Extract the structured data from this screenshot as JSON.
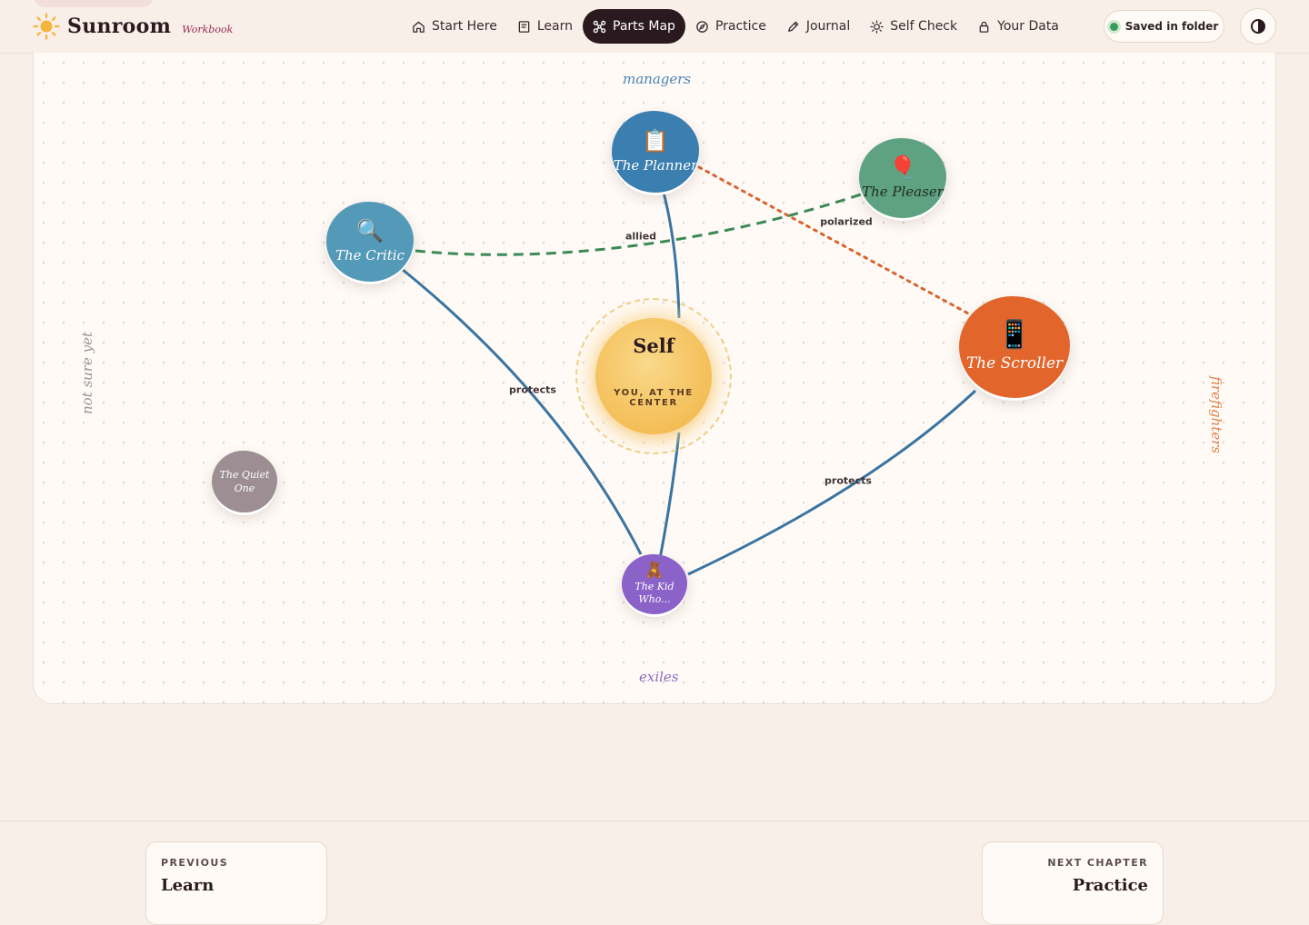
{
  "brand": {
    "name": "Sunroom",
    "subtitle": "Workbook"
  },
  "nav": {
    "items": [
      {
        "label": "Start Here",
        "icon": "home-icon",
        "active": false
      },
      {
        "label": "Learn",
        "icon": "book-icon",
        "active": false
      },
      {
        "label": "Parts Map",
        "icon": "network-icon",
        "active": true
      },
      {
        "label": "Practice",
        "icon": "compass-icon",
        "active": false
      },
      {
        "label": "Journal",
        "icon": "pencil-icon",
        "active": false
      },
      {
        "label": "Self Check",
        "icon": "sun-small-icon",
        "active": false
      },
      {
        "label": "Your Data",
        "icon": "lock-icon",
        "active": false
      }
    ],
    "saved_label": "Saved in folder",
    "theme_icon": "contrast-icon"
  },
  "map": {
    "zones": {
      "managers": "managers",
      "exiles": "exiles",
      "firefighters": "firefighters",
      "unsure": "not sure yet"
    },
    "self": {
      "title": "Self",
      "subtitle": "YOU, AT THE CENTER",
      "color": "#f4be57"
    },
    "parts": [
      {
        "name": "The Planner",
        "emoji": "📋",
        "color": "#3a7fb0",
        "group": "managers"
      },
      {
        "name": "The Pleaser",
        "emoji": "🎈",
        "color": "#5ea282",
        "group": "managers"
      },
      {
        "name": "The Critic",
        "emoji": "🔍",
        "color": "#5399b8",
        "group": "managers"
      },
      {
        "name": "The Scroller",
        "emoji": "📱",
        "color": "#e2652b",
        "group": "firefighters"
      },
      {
        "name": "The Quiet One",
        "emoji": "",
        "color": "#9c8e93",
        "group": "not sure yet"
      },
      {
        "name": "The Kid Who...",
        "emoji": "🧸",
        "color": "#8a62c8",
        "group": "exiles"
      }
    ],
    "edges": [
      {
        "label": "allied",
        "style": "dashed",
        "color": "#3a8a55"
      },
      {
        "label": "polarized",
        "style": "dotted",
        "color": "#d8642e"
      },
      {
        "label": "protects",
        "style": "solid",
        "color": "#3a74a0"
      },
      {
        "label": "protects",
        "style": "solid",
        "color": "#3a74a0"
      }
    ]
  },
  "footer": {
    "prev": {
      "kicker": "PREVIOUS",
      "title": "Learn"
    },
    "next": {
      "kicker": "NEXT CHAPTER",
      "title": "Practice"
    }
  }
}
